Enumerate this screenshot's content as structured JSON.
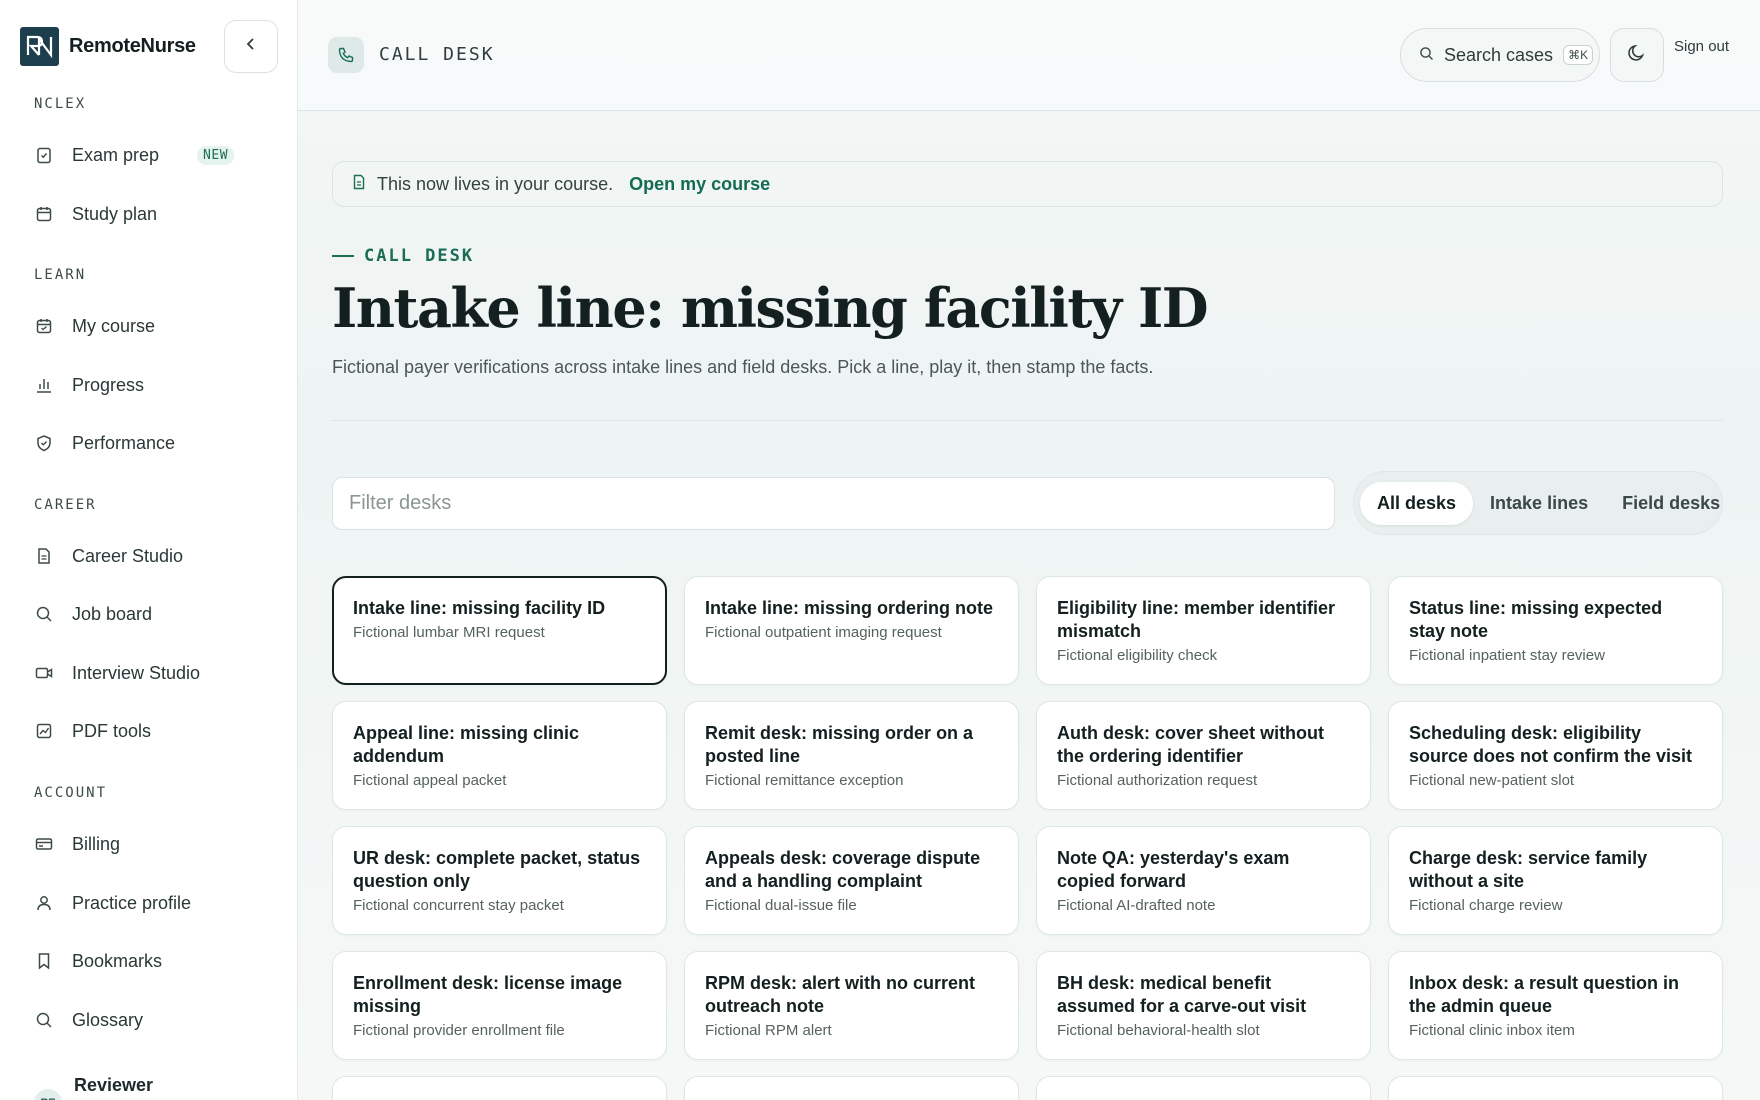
{
  "brand": {
    "name": "RemoteNurse"
  },
  "sidebar": {
    "sections": [
      {
        "title": "NCLEX",
        "items": [
          {
            "label": "Exam prep",
            "badge": "NEW",
            "icon": "clipboard-check-icon"
          },
          {
            "label": "Study plan",
            "icon": "calendar-icon"
          }
        ]
      },
      {
        "title": "LEARN",
        "items": [
          {
            "label": "My course",
            "icon": "calendar-check-icon"
          },
          {
            "label": "Progress",
            "icon": "bar-chart-icon"
          },
          {
            "label": "Performance",
            "icon": "shield-check-icon"
          }
        ]
      },
      {
        "title": "CAREER",
        "items": [
          {
            "label": "Career Studio",
            "icon": "document-icon"
          },
          {
            "label": "Job board",
            "icon": "search-icon"
          },
          {
            "label": "Interview Studio",
            "icon": "video-icon"
          },
          {
            "label": "PDF tools",
            "icon": "chart-box-icon"
          }
        ]
      },
      {
        "title": "ACCOUNT",
        "items": [
          {
            "label": "Billing",
            "icon": "credit-card-icon"
          },
          {
            "label": "Practice profile",
            "icon": "user-icon"
          },
          {
            "label": "Bookmarks",
            "icon": "bookmark-icon"
          },
          {
            "label": "Glossary",
            "icon": "search-icon"
          }
        ]
      }
    ],
    "reviewer": {
      "name": "Reviewer",
      "initials": "RE"
    }
  },
  "topbar": {
    "title": "CALL DESK",
    "search_label": "Search cases",
    "search_shortcut": "⌘K",
    "sign_out": "Sign out"
  },
  "notice": {
    "text": "This now lives in your course.",
    "link": "Open my course"
  },
  "header": {
    "eyebrow": "CALL DESK",
    "title": "Intake line: missing facility ID",
    "subtitle": "Fictional payer verifications across intake lines and field desks. Pick a line, play it, then stamp the facts."
  },
  "filter": {
    "placeholder": "Filter desks"
  },
  "tabs": [
    {
      "label": "All desks",
      "active": true
    },
    {
      "label": "Intake lines",
      "active": false
    },
    {
      "label": "Field desks",
      "active": false
    }
  ],
  "cards": [
    {
      "title": "Intake line: missing facility ID",
      "sub": "Fictional lumbar MRI request",
      "selected": true
    },
    {
      "title": "Intake line: missing ordering note",
      "sub": "Fictional outpatient imaging request"
    },
    {
      "title": "Eligibility line: member identifier mismatch",
      "sub": "Fictional eligibility check"
    },
    {
      "title": "Status line: missing expected stay note",
      "sub": "Fictional inpatient stay review"
    },
    {
      "title": "Appeal line: missing clinic addendum",
      "sub": "Fictional appeal packet"
    },
    {
      "title": "Remit desk: missing order on a posted line",
      "sub": "Fictional remittance exception"
    },
    {
      "title": "Auth desk: cover sheet without the ordering identifier",
      "sub": "Fictional authorization request"
    },
    {
      "title": "Scheduling desk: eligibility source does not confirm the visit",
      "sub": "Fictional new-patient slot"
    },
    {
      "title": "UR desk: complete packet, status question only",
      "sub": "Fictional concurrent stay packet"
    },
    {
      "title": "Appeals desk: coverage dispute and a handling complaint",
      "sub": "Fictional dual-issue file"
    },
    {
      "title": "Note QA: yesterday's exam copied forward",
      "sub": "Fictional AI-drafted note"
    },
    {
      "title": "Charge desk: service family without a site",
      "sub": "Fictional charge review"
    },
    {
      "title": "Enrollment desk: license image missing",
      "sub": "Fictional provider enrollment file"
    },
    {
      "title": "RPM desk: alert with no current outreach note",
      "sub": "Fictional RPM alert"
    },
    {
      "title": "BH desk: medical benefit assumed for a carve-out visit",
      "sub": "Fictional behavioral-health slot"
    },
    {
      "title": "Inbox desk: a result question in the admin queue",
      "sub": "Fictional clinic inbox item"
    }
  ],
  "colors": {
    "accent": "#1b6d55",
    "ink": "#13201f",
    "brand_logo": "#1d3f4d"
  }
}
